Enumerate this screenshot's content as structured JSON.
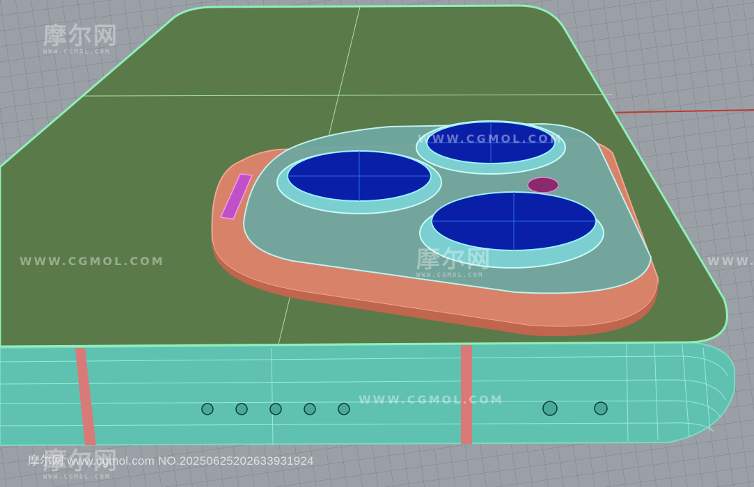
{
  "scene": {
    "viewport_background": "#9aa0a6",
    "grid_color": "#7c8288",
    "phone_back_color": "#5a7a4a",
    "phone_edge_color": "#7fd8c4",
    "frame_color": "#5fc2b0",
    "bump_plate_color": "#d9826a",
    "camera_module_color": "#6fa6a0",
    "lens_color": "#0a1fa8",
    "antenna_band_color": "#d97a78",
    "sensor_color": "#c050c8",
    "axis_color": "#c0392b"
  },
  "watermarks": {
    "logo_cn": "摩尔网",
    "logo_en": "WWW.CGMOL.COM",
    "url": "WWW.CGMOL.COM",
    "footer": "摩尔网 www.cgmol.com NO.20250625202633931924"
  }
}
